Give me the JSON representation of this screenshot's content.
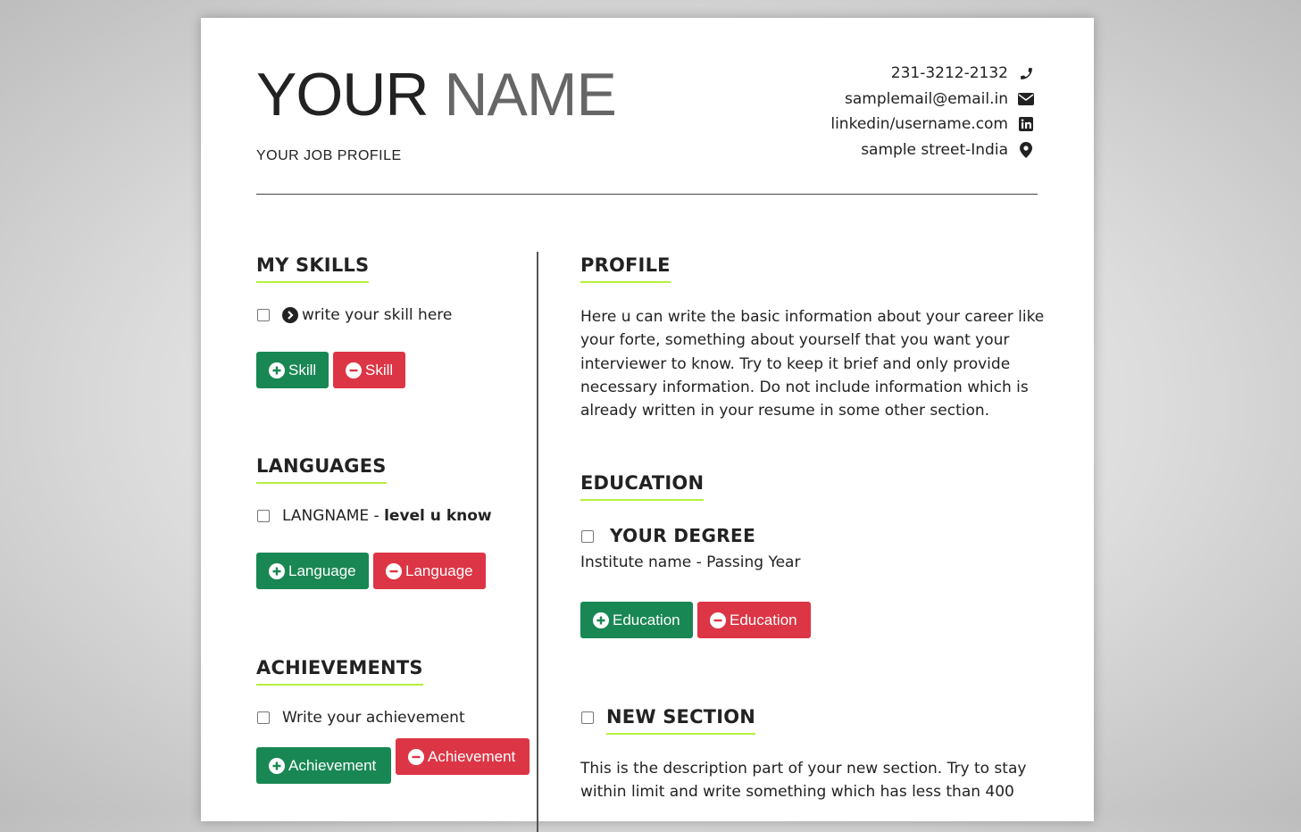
{
  "header": {
    "first_name": "YOUR",
    "last_name": "NAME",
    "job_profile": "YOUR JOB PROFILE"
  },
  "contacts": [
    {
      "text": "231-3212-2132",
      "icon": "phone-icon"
    },
    {
      "text": "samplemail@email.in",
      "icon": "envelope-icon"
    },
    {
      "text": "linkedin/username.com",
      "icon": "linkedin-icon"
    },
    {
      "text": "sample street-India",
      "icon": "location-pin-icon"
    }
  ],
  "skills": {
    "title": "MY SKILLS",
    "item": "write your skill here",
    "add_label": "Skill",
    "remove_label": "Skill"
  },
  "languages": {
    "title": "LANGUAGES",
    "lang_name": "LANGNAME",
    "separator": " - ",
    "level": "level u know",
    "add_label": "Language",
    "remove_label": "Language"
  },
  "achievements": {
    "title": "ACHIEVEMENTS",
    "item": "Write your achievement",
    "add_label": "Achievement",
    "remove_label": "Achievement"
  },
  "profile": {
    "title": "PROFILE",
    "lines": [
      "Here u can write the basic information about your career like",
      "your forte, something about yourself that you want your",
      "interviewer to know. Try to keep it brief and only provide",
      "necessary information. Do not include information which is",
      "already written in your resume in some other section."
    ]
  },
  "education": {
    "title": "EDUCATION",
    "degree": "YOUR DEGREE",
    "institute": "Institute name - Passing Year",
    "add_label": "Education",
    "remove_label": "Education"
  },
  "new_section": {
    "title": "NEW SECTION",
    "lines": [
      "This is the description part of your new section. Try to stay",
      "within limit and write something which has less than 400"
    ]
  },
  "colors": {
    "accent": "#b6f03c",
    "add_button": "#198754",
    "remove_button": "#dc3545"
  }
}
